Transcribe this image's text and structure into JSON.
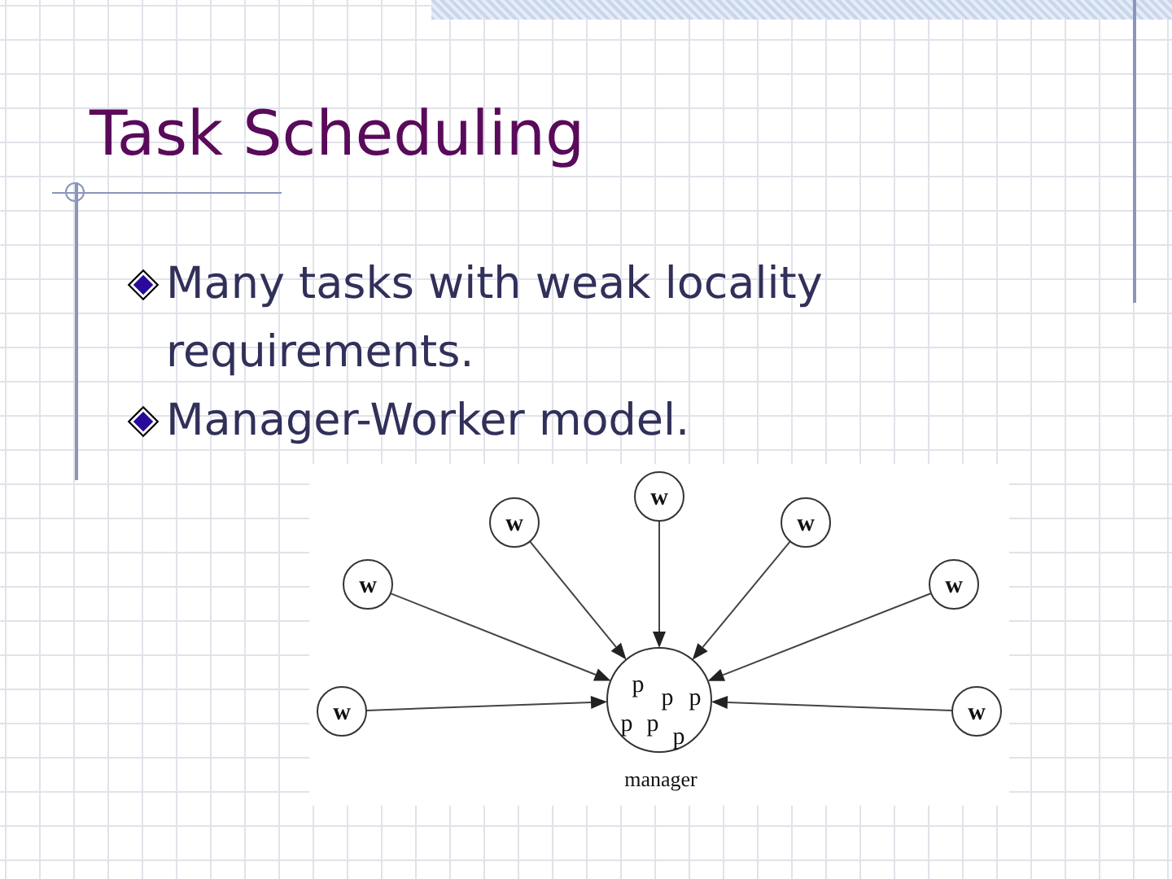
{
  "title": "Task Scheduling",
  "bullets": [
    {
      "text": "Many tasks with weak locality requirements."
    },
    {
      "text": "Manager-Worker model."
    }
  ],
  "diagram": {
    "workers": [
      {
        "label": "w"
      },
      {
        "label": "w"
      },
      {
        "label": "w"
      },
      {
        "label": "w"
      },
      {
        "label": "w"
      },
      {
        "label": "w"
      },
      {
        "label": "w"
      }
    ],
    "manager": {
      "label": "manager",
      "processes": [
        "p",
        "p",
        "p",
        "p",
        "p",
        "p"
      ]
    }
  }
}
